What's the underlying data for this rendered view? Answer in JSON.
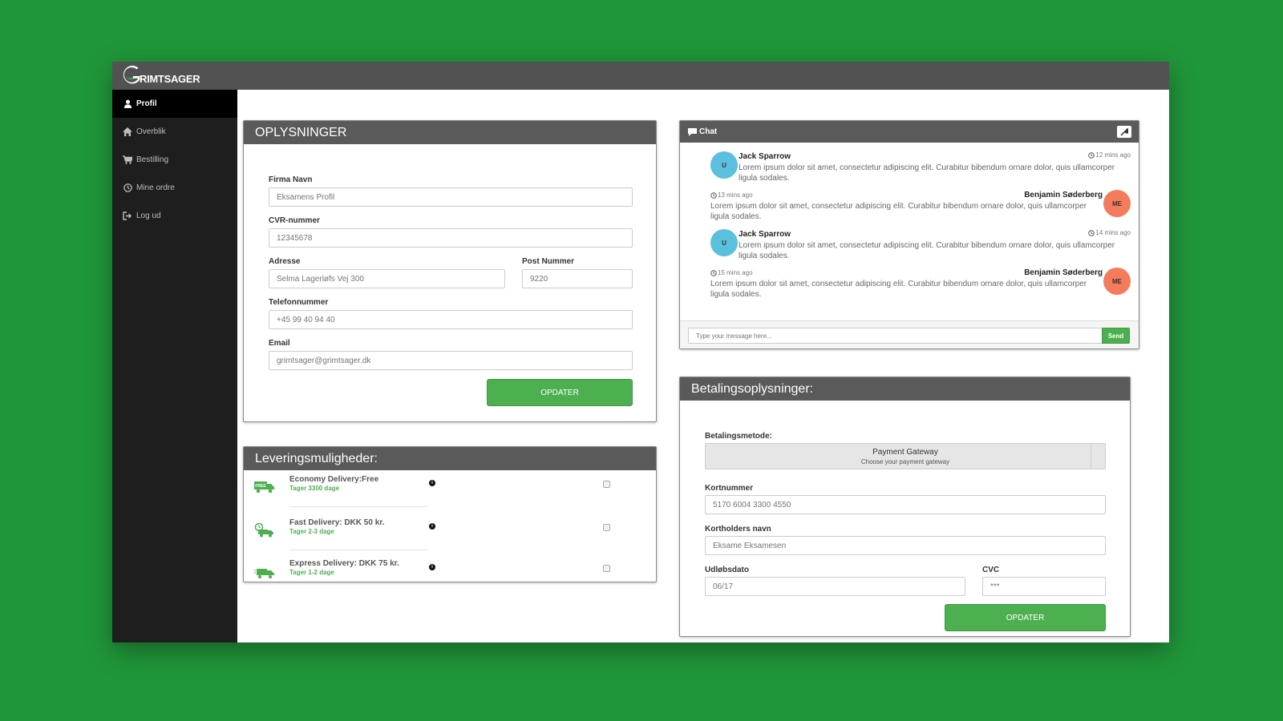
{
  "brand": {
    "logo_text": "RIMTSAGER"
  },
  "sidebar": {
    "items": [
      {
        "label": "Profil",
        "icon": "user-icon"
      },
      {
        "label": "Overblik",
        "icon": "home-icon"
      },
      {
        "label": "Bestilling",
        "icon": "cart-icon"
      },
      {
        "label": "Mine ordre",
        "icon": "clock-icon"
      },
      {
        "label": "Log ud",
        "icon": "sign-out-icon"
      }
    ]
  },
  "oplysninger": {
    "title": "OPLYSNINGER",
    "firma_label": "Firma Navn",
    "firma_placeholder": "Eksamens Profil",
    "cvr_label": "CVR-nummer",
    "cvr_placeholder": "12345678",
    "adresse_label": "Adresse",
    "adresse_placeholder": "Selma Lagerløfs Vej 300",
    "post_label": "Post Nummer",
    "post_placeholder": "9220",
    "tlf_label": "Telefonnummer",
    "tlf_placeholder": "+45 99 40 94 40",
    "email_label": "Email",
    "email_placeholder": "grimtsager@grimtsager.dk",
    "button": "OPDATER"
  },
  "levering": {
    "title": "Leveringsmuligheder:",
    "options": [
      {
        "title": "Economy Delivery:Free",
        "sub": "Tager 3300 dage",
        "icon": "free-truck-icon",
        "badge": "FREE"
      },
      {
        "title": "Fast Delivery: DKK 50 kr.",
        "sub": "Tager 2-3 dage",
        "icon": "fast-truck-icon"
      },
      {
        "title": "Express Delivery: DKK 75 kr.",
        "sub": "Tager 1-2 dage",
        "icon": "express-truck-icon"
      }
    ]
  },
  "chat": {
    "title": "Chat",
    "messages": [
      {
        "name": "Jack Sparrow",
        "time": "12 mins ago",
        "text": "Lorem ipsum dolor sit amet, consectetur adipiscing elit. Curabitur bibendum ornare dolor, quis ullamcorper ligula sodales.",
        "avatar": "U",
        "side": "left"
      },
      {
        "name": "Benjamin Søderberg",
        "time": "13 mins ago",
        "text": "Lorem ipsum dolor sit amet, consectetur adipiscing elit. Curabitur bibendum ornare dolor, quis ullamcorper ligula sodales.",
        "avatar": "ME",
        "side": "right"
      },
      {
        "name": "Jack Sparrow",
        "time": "14 mins ago",
        "text": "Lorem ipsum dolor sit amet, consectetur adipiscing elit. Curabitur bibendum ornare dolor, quis ullamcorper ligula sodales.",
        "avatar": "U",
        "side": "left"
      },
      {
        "name": "Benjamin Søderberg",
        "time": "15 mins ago",
        "text": "Lorem ipsum dolor sit amet, consectetur adipiscing elit. Curabitur bibendum ornare dolor, quis ullamcorper ligula sodales.",
        "avatar": "ME",
        "side": "right"
      }
    ],
    "input_placeholder": "Type your message here...",
    "send_label": "Send"
  },
  "betaling": {
    "title": "Betalingsoplysninger:",
    "metode_label": "Betalingsmetode:",
    "gateway_title": "Payment Gateway",
    "gateway_sub": "Choose your payment gateway",
    "kort_label": "Kortnummer",
    "kort_placeholder": "5170 6004 3300 4550",
    "holder_label": "Kortholders navn",
    "holder_placeholder": "Eksame Eksamesen",
    "udlob_label": "Udløbsdato",
    "udlob_placeholder": "06/17",
    "cvc_label": "CVC",
    "cvc_placeholder": "***",
    "button": "OPDATER"
  },
  "colors": {
    "background": "#20963a",
    "accent": "#4caf50",
    "panel_header": "#5a5a5a",
    "sidebar": "#1e1e1e",
    "avatar_user": "#5bc0de",
    "avatar_me": "#f47c5c"
  }
}
